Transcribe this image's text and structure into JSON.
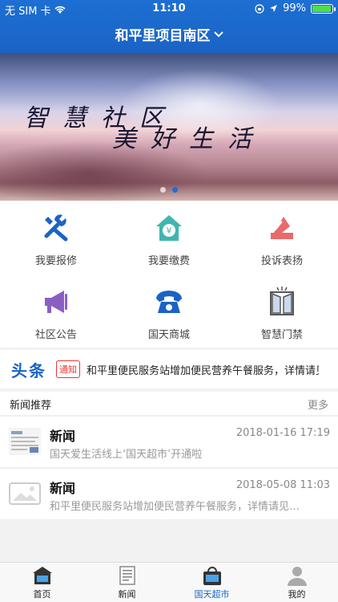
{
  "status_bar": {
    "carrier": "无 SIM 卡",
    "time": "11:10",
    "battery": "99%",
    "battery_level": 0.99
  },
  "nav": {
    "title": "和平里项目南区"
  },
  "banner": {
    "line1": "智慧社区",
    "line2": "美好生活",
    "page_count": 2,
    "active_page": 1
  },
  "services": [
    {
      "label": "我要报修",
      "icon": "tools-icon"
    },
    {
      "label": "我要缴费",
      "icon": "payment-icon"
    },
    {
      "label": "投诉表扬",
      "icon": "complaint-icon"
    },
    {
      "label": "社区公告",
      "icon": "megaphone-icon"
    },
    {
      "label": "国天商城",
      "icon": "phone-icon"
    },
    {
      "label": "智慧门禁",
      "icon": "door-icon"
    }
  ],
  "headline": {
    "title": "头条",
    "badge": "通知",
    "text": "和平里便民服务站增加便民营养午餐服务，详情请见…"
  },
  "news": {
    "section_title": "新闻推荐",
    "more_label": "更多",
    "items": [
      {
        "title": "新闻",
        "date": "2018-01-16 17:19",
        "summary": "国天爱生活线上‘国天超市’开通啦"
      },
      {
        "title": "新闻",
        "date": "2018-05-08 11:03",
        "summary": "和平里便民服务站增加便民营养午餐服务，详情请见…"
      }
    ]
  },
  "tabs": [
    {
      "label": "首页",
      "icon": "home-icon"
    },
    {
      "label": "新闻",
      "icon": "news-icon"
    },
    {
      "label": "国天超市",
      "icon": "shopping-bag-icon"
    },
    {
      "label": "我的",
      "icon": "user-icon"
    }
  ],
  "active_tab": 2,
  "colors": {
    "primary": "#1b63c5",
    "tools": "#1b63c5",
    "payment": "#3fb6b0",
    "complaint": "#e86a6a",
    "megaphone": "#8a5fc4",
    "phone": "#1b63c5",
    "alert": "#e33333"
  }
}
